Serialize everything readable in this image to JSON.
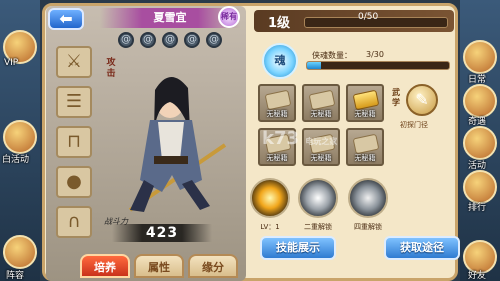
{
  "hero": {
    "name": "夏雪宜",
    "quality": "稀有",
    "weapon_tag": "攻击",
    "power_label": "战斗力",
    "power": "423"
  },
  "left_sidebar": {
    "labels": [
      "VIP",
      "白活动",
      "阵容"
    ]
  },
  "right_sidebar": {
    "labels": [
      "日常",
      "奇遇",
      "活动",
      "排行",
      "好友"
    ]
  },
  "level": {
    "label": "1级",
    "exp": "0/50"
  },
  "fragments": {
    "label": "侠魂数量：",
    "count": "3/30",
    "progress": 0.1,
    "icon_text": "魂"
  },
  "books": [
    {
      "label": "无秘籍",
      "gold": false
    },
    {
      "label": "无秘籍",
      "gold": false
    },
    {
      "label": "无秘籍",
      "gold": true
    },
    {
      "label": "无秘籍",
      "gold": false
    },
    {
      "label": "无秘籍",
      "gold": false
    },
    {
      "label": "无秘籍",
      "gold": false
    }
  ],
  "martial": {
    "label": "武学",
    "sub": "初探门径"
  },
  "skills": [
    {
      "label": "LV：1"
    },
    {
      "label": "二重解锁"
    },
    {
      "label": "四重解锁"
    }
  ],
  "buttons": {
    "skill_display": "技能展示",
    "get_route": "获取途径"
  },
  "tabs": [
    {
      "label": "培养",
      "active": true
    },
    {
      "label": "属性",
      "active": false
    },
    {
      "label": "缘分",
      "active": false
    }
  ],
  "watermark": {
    "text": "k73",
    "sub": "电玩之家"
  }
}
